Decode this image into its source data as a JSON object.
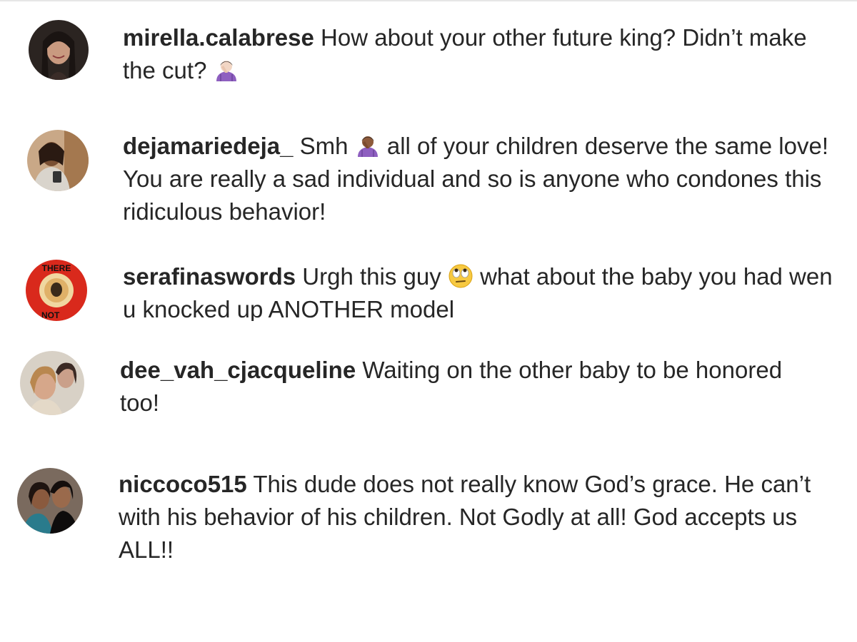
{
  "comments": [
    {
      "username": "mirella.calabrese",
      "text_before": "How about your other future king? Didn’t make the cut?",
      "emoji": "person-facepalming-light-icon",
      "text_after": ""
    },
    {
      "username": "dejamariedeja_",
      "text_before": "Smh",
      "emoji": "person-facepalming-medium-dark-icon",
      "text_after": "all of your children deserve the same love! You are really a sad individual and so is anyone who condones this ridiculous behavior!"
    },
    {
      "username": "serafinaswords",
      "text_before": "Urgh this guy",
      "emoji": "face-with-rolling-eyes-icon",
      "text_after": "what about the baby you had wen u knocked up ANOTHER model"
    },
    {
      "username": "dee_vah_cjacqueline",
      "text_before": "Waiting on the other baby to be honored too!",
      "emoji": "",
      "text_after": ""
    },
    {
      "username": "niccoco515",
      "text_before": "This dude does not really know God’s grace. He can’t with his behavior of his children. Not Godly at all! God accepts us ALL!!",
      "emoji": "",
      "text_after": ""
    }
  ],
  "colors": {
    "text": "#262626",
    "divider": "#e6e6e6"
  }
}
